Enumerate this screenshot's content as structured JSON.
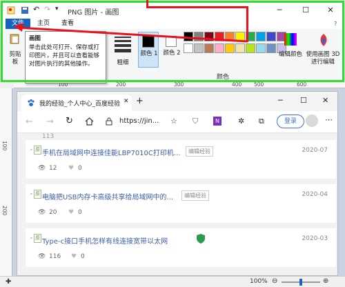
{
  "window": {
    "title": "PNG 图片 - 画图"
  },
  "tabs": {
    "file": "文件",
    "home": "主页",
    "view": "查看"
  },
  "ribbon": {
    "clipboard_label": "剪贴板",
    "color1_label": "颜色 1",
    "color2_label": "颜色 2",
    "edit_colors_label": "编辑颜色",
    "paint3d_label": "使用画图 3D 进行编辑",
    "colors_group": "颜色",
    "size_label": "粗细"
  },
  "tooltip": {
    "title": "画图",
    "body": "单击此处可打开、保存或打印图片，并且可以查看能够对图片执行的其他操作。"
  },
  "rulers": {
    "h_ticks": [
      "100",
      "200",
      "300",
      "400",
      "500",
      "600"
    ],
    "v_ticks": [
      "100",
      "200"
    ]
  },
  "colors": {
    "accent": "#1565c0",
    "frame": "#2ee02e",
    "arrow": "#e8121b",
    "palette_row1": [
      "#000000",
      "#7f7f7f",
      "#880015",
      "#ed1c24",
      "#ff7f27",
      "#fff200",
      "#22b14c",
      "#00a2e8",
      "#3f48cc",
      "#a349a4"
    ],
    "palette_row2": [
      "#ffffff",
      "#c3c3c3",
      "#b97a57",
      "#ffaec9",
      "#ffc90e",
      "#efe4b0",
      "#b5e61d",
      "#99d9ea",
      "#7092be",
      "#c8bfe7"
    ]
  },
  "browser": {
    "tab_title": "我的经验_个人中心_百度经验",
    "url": "https://jin...",
    "login": "登录",
    "items": [
      {
        "title": "手机在局域网中连接佳能LBP7010C打印机...",
        "tag": "编辑经验",
        "date": "2020-07",
        "views": "12",
        "likes": "0"
      },
      {
        "title": "电脑把USB内存卡高级共享给局域网中的...",
        "tag": "编辑经验",
        "date": "2020-04",
        "views": "20",
        "likes": "0"
      },
      {
        "title": "Type-c接口手机怎样有线连接宽带以太网",
        "tag": "",
        "date": "2020-03",
        "views": "116",
        "likes": "0"
      }
    ],
    "top_partial_views": "113"
  },
  "status": {
    "zoom": "100%"
  }
}
